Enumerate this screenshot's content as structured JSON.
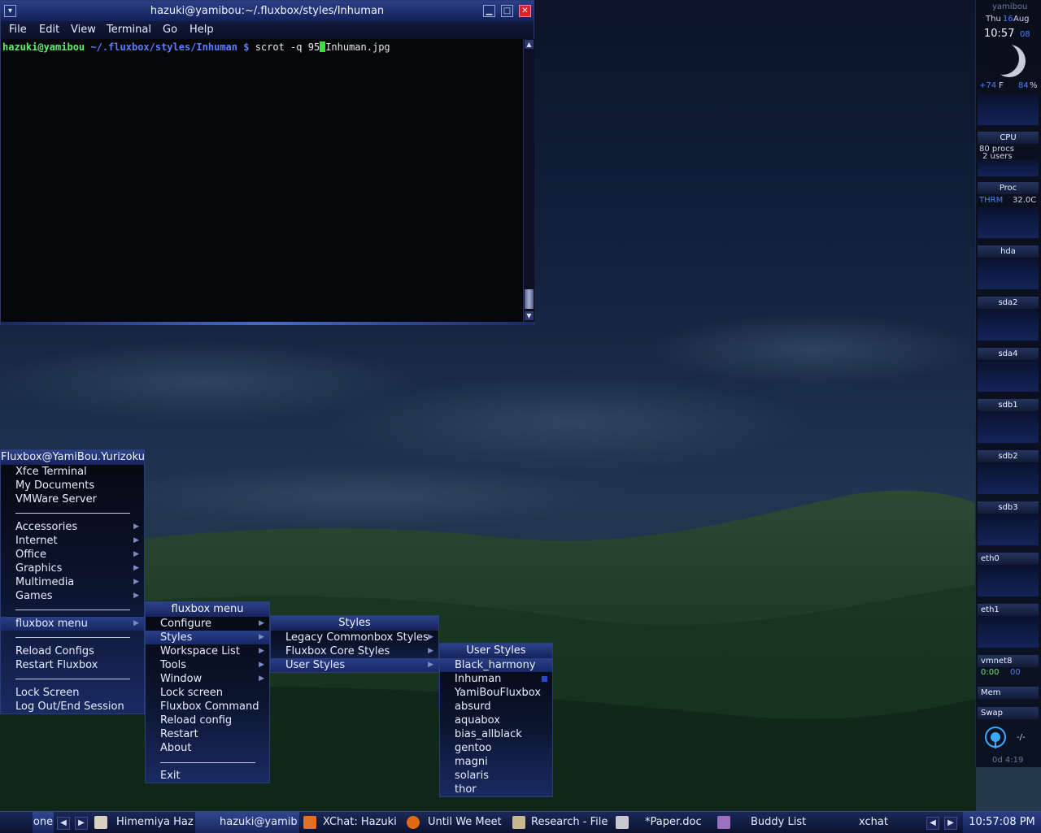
{
  "terminal": {
    "title": "hazuki@yamibou:~/.fluxbox/styles/Inhuman",
    "menubar": [
      "File",
      "Edit",
      "View",
      "Terminal",
      "Go",
      "Help"
    ],
    "prompt_user": "hazuki@yamibou",
    "prompt_path": "~/.fluxbox/styles/Inhuman $",
    "command_before_cursor": "scrot -q 95",
    "command_after_cursor": "Inhuman.jpg"
  },
  "root_menu": {
    "title": "Fluxbox@YamiBou.Yurizoku",
    "items": [
      "Xfce Terminal",
      "My Documents",
      "VMWare Server",
      "Accessories",
      "Internet",
      "Office",
      "Graphics",
      "Multimedia",
      "Games",
      "fluxbox menu",
      "Reload Configs",
      "Restart Fluxbox",
      "Lock Screen",
      "Log Out/End Session"
    ]
  },
  "fluxbox_menu": {
    "title": "fluxbox menu",
    "items": [
      "Configure",
      "Styles",
      "Workspace List",
      "Tools",
      "Window",
      "Lock screen",
      "Fluxbox Command",
      "Reload config",
      "Restart",
      "About",
      "Exit"
    ]
  },
  "styles_menu": {
    "title": "Styles",
    "items": [
      "Legacy Commonbox Styles",
      "Fluxbox Core Styles",
      "User Styles"
    ]
  },
  "user_styles_menu": {
    "title": "User Styles",
    "items": [
      "Black_harmony",
      "Inhuman",
      "YamiBouFluxbox",
      "absurd",
      "aquabox",
      "bias_allblack",
      "gentoo",
      "magni",
      "solaris",
      "thor"
    ],
    "selected": "Inhuman"
  },
  "conky": {
    "host": "yamibou",
    "day": "Thu",
    "date_num": "16",
    "month": "Aug",
    "time": "10:57",
    "year": "08",
    "temp": "+74",
    "temp_unit": "F",
    "humidity": "84",
    "pct_sign": "%",
    "cpu_pct": "3%",
    "cpu_label": "CPU",
    "procs": "80 procs",
    "users": "2 users",
    "proc_label": "Proc",
    "thrm_label": "THRM",
    "thrm_value": "32.0C",
    "disks": [
      {
        "name": "hda",
        "value": "0"
      },
      {
        "name": "sda2",
        "value": "0"
      },
      {
        "name": "sda4",
        "value": "0"
      },
      {
        "name": "sdb1",
        "value": "0"
      },
      {
        "name": "sdb2",
        "value": "0"
      },
      {
        "name": "sdb3",
        "value": "0"
      }
    ],
    "proc_value": "0",
    "eth0": {
      "name": "eth0",
      "value": "0"
    },
    "eth1": {
      "name": "eth1",
      "value": "0"
    },
    "vmnet8": {
      "name": "vmnet8",
      "up": "0:00",
      "down": "00"
    },
    "mem_label": "Mem",
    "swap_label": "Swap",
    "load": "-/-",
    "uptime": "0d 4:19"
  },
  "taskbar": {
    "workspace": "one",
    "tasks": [
      "Himemiya Haz",
      "hazuki@yamib",
      "XChat: Hazuki",
      "Until We Meet",
      "Research - File",
      "*Paper.doc",
      "Buddy List",
      "xchat"
    ],
    "clock": "10:57:08 PM"
  },
  "colors": {
    "accent": "#2b3f88",
    "prompt_green": "#5df16a",
    "prompt_blue": "#5d7dff"
  }
}
